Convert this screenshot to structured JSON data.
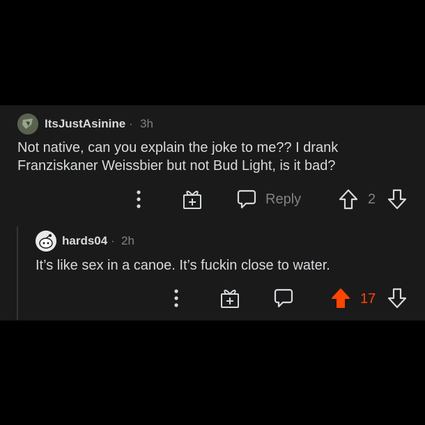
{
  "comments": [
    {
      "author": "ItsJustAsinine",
      "separator": "·",
      "age": "3h",
      "body_line1": "Not native, can you explain the joke to me?? I drank",
      "body_line2": "Franziskaner Weissbier but not Bud Light, is it bad?",
      "reply_label": "Reply",
      "score": "2",
      "voted": "none"
    },
    {
      "author": "hards04",
      "separator": "·",
      "age": "2h",
      "body_line1": "It’s like sex in a canoe. It’s fuckin close to water.",
      "score": "17",
      "voted": "up"
    }
  ],
  "colors": {
    "background": "#000000",
    "card": "#1a1a1b",
    "text": "#d7dadc",
    "muted": "#818384",
    "upvote": "#ff4500"
  },
  "icons": [
    "more-options-icon",
    "award-gift-icon",
    "reply-bubble-icon",
    "upvote-arrow-icon",
    "downvote-arrow-icon"
  ]
}
